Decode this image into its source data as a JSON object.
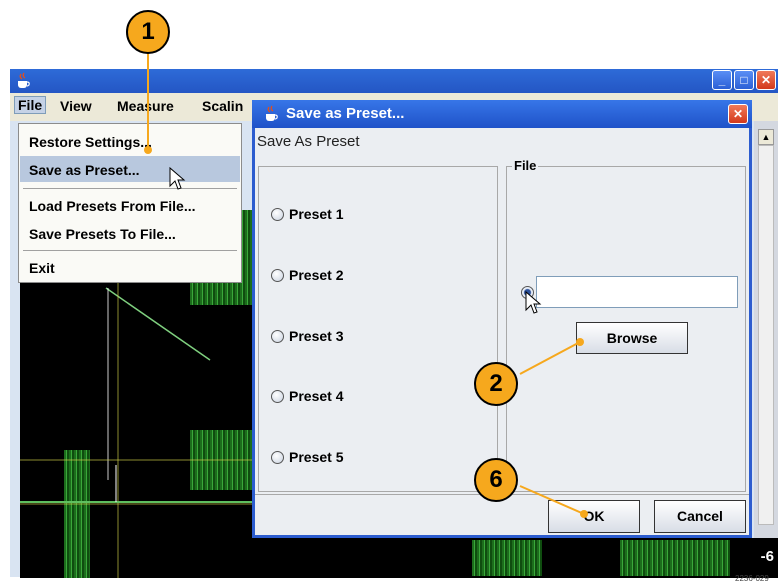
{
  "window": {
    "icon": "java-cup-icon",
    "buttons": {
      "minimize": "_",
      "maximize": "□",
      "close": "✕"
    }
  },
  "menubar": {
    "items": [
      "File",
      "View",
      "Measure",
      "Scalin"
    ]
  },
  "file_menu": {
    "items": [
      "Restore Settings...",
      "Save as Preset...",
      "Load Presets From File...",
      "Save Presets To File...",
      "Exit"
    ],
    "highlighted": "Save as Preset..."
  },
  "dialog": {
    "title": "Save as Preset...",
    "close_glyph": "✕",
    "subtitle": "Save As Preset",
    "presets": [
      "Preset 1",
      "Preset 2",
      "Preset 3",
      "Preset 4",
      "Preset 5"
    ],
    "file_group_label": "File",
    "file_path_value": "",
    "browse_label": "Browse",
    "ok_label": "OK",
    "cancel_label": "Cancel"
  },
  "background": {
    "readout": "-6"
  },
  "callouts": [
    "1",
    "2",
    "6"
  ],
  "figure_ref": "2236-029",
  "colors": {
    "titlebar": "#2456c4",
    "callout": "#f6a81d",
    "waveform": "#3aa83a",
    "menu_highlight": "#b8c8de"
  }
}
